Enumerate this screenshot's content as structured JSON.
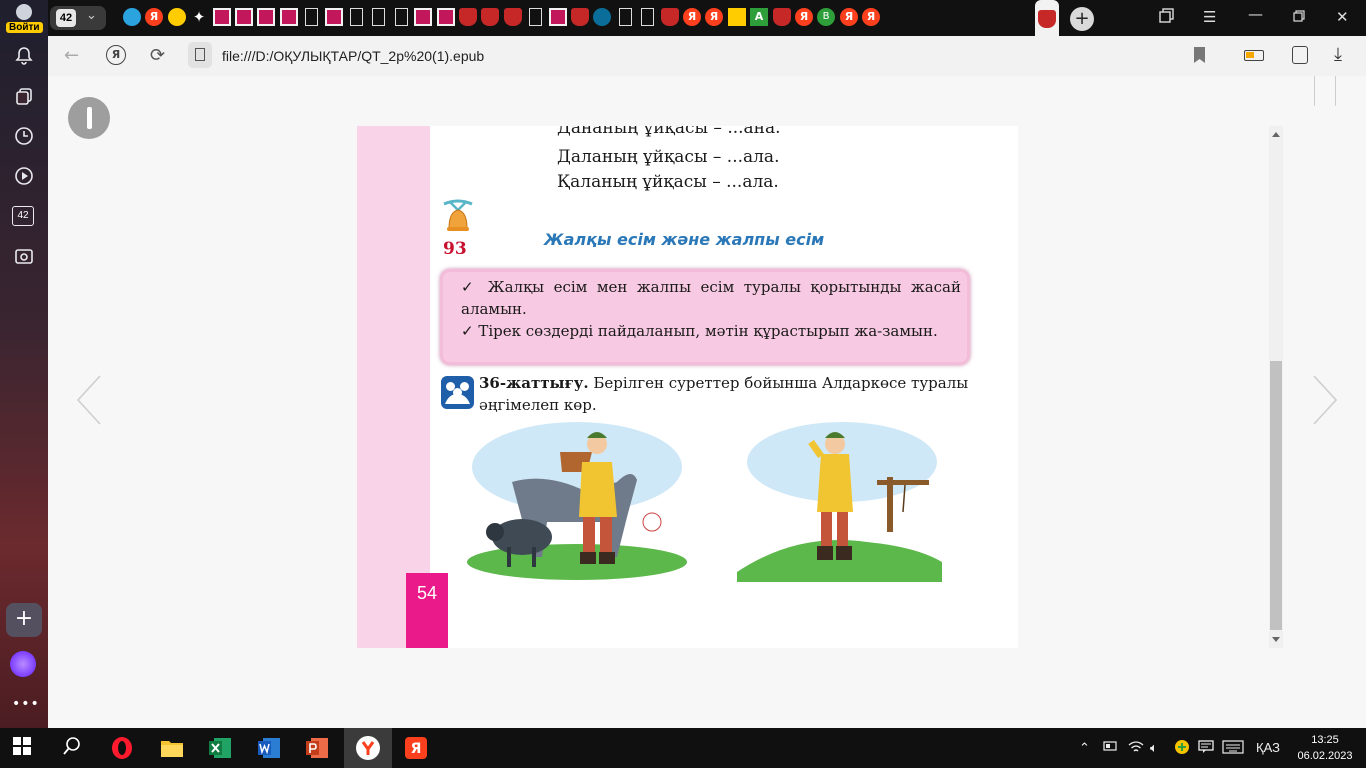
{
  "sidebar": {
    "login_label": "Войти",
    "tab_counter": "42"
  },
  "tabstrip": {
    "tab_count": "42",
    "tab_icons": [
      "telegram",
      "yandex",
      "play",
      "star",
      "wordwall",
      "wordwall",
      "wordwall",
      "wordwall",
      "doc",
      "wordwall",
      "doc",
      "doc",
      "doc",
      "wordwall",
      "wordwall",
      "shield",
      "shield",
      "shield",
      "doc",
      "wordwall",
      "shield",
      "globe",
      "doc",
      "doc",
      "shield",
      "yandex",
      "yandex",
      "yellow",
      "triangle",
      "shield",
      "yandex",
      "green",
      "yandex",
      "yandex"
    ],
    "new_tab_symbol": "+"
  },
  "addressbar": {
    "url": "file:///D:/ОҚУЛЫҚТАР/QT_2p%20(1).epub"
  },
  "reader": {
    "rhyme_lines": [
      "Дананың ұйқасы – ...ана.",
      "Даланың ұйқасы – ...ала.",
      "Қаланың ұйқасы – ...ала."
    ],
    "lesson_number": "93",
    "lesson_title": "Жалқы есім және жалпы есім",
    "goals": [
      "✓ Жалқы есім мен жалпы есім туралы қорытынды жасай аламын.",
      "✓ Тірек сөздерді пайдаланып, мәтін құрастырып жа-замын."
    ],
    "task_label": "36-жаттығу.",
    "task_text": " Берілген суреттер бойынша Алдаркөсе туралы әңгімелеп көр.",
    "page_number": "54"
  },
  "taskbar": {
    "language": "ҚАЗ",
    "time": "13:25",
    "date": "06.02.2023"
  },
  "colors": {
    "accent_pink": "#ea1a8a",
    "lesson_blue": "#2b78b8",
    "lesson_red": "#c8102e"
  }
}
